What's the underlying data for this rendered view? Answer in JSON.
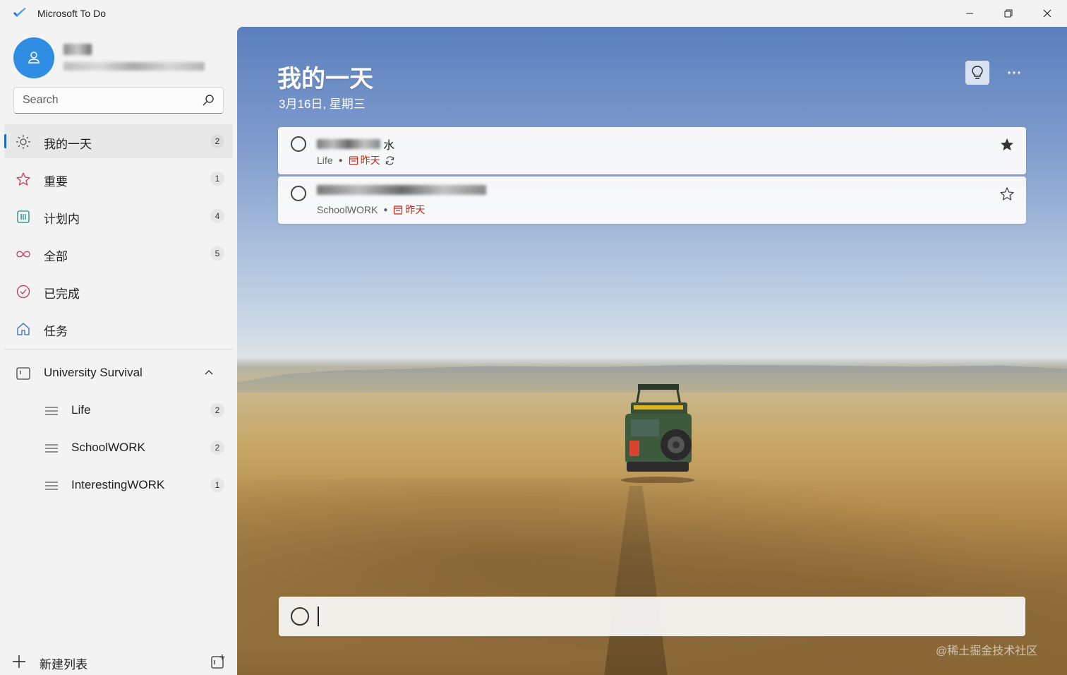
{
  "window": {
    "title": "Microsoft To Do",
    "controls": [
      "minimize",
      "restore",
      "close"
    ]
  },
  "sidebar": {
    "search": {
      "placeholder": "Search",
      "value": ""
    },
    "nav": [
      {
        "label": "我的一天",
        "count": "2",
        "icon": "sun-icon",
        "active": true
      },
      {
        "label": "重要",
        "count": "1",
        "icon": "star-icon"
      },
      {
        "label": "计划内",
        "count": "4",
        "icon": "calendar-grid-icon"
      },
      {
        "label": "全部",
        "count": "5",
        "icon": "infinity-icon"
      },
      {
        "label": "已完成",
        "count": "",
        "icon": "check-circle-icon"
      },
      {
        "label": "任务",
        "count": "",
        "icon": "home-icon"
      }
    ],
    "group": {
      "label": "University Survival",
      "expanded": true,
      "lists": [
        {
          "label": "Life",
          "count": "2"
        },
        {
          "label": "SchoolWORK",
          "count": "2"
        },
        {
          "label": "InterestingWORK",
          "count": "1"
        }
      ]
    },
    "new_list_label": "新建列表"
  },
  "main": {
    "title": "我的一天",
    "date": "3月16日, 星期三",
    "tasks": [
      {
        "title_visible_suffix": "水",
        "list": "Life",
        "due": "昨天",
        "repeat": true,
        "important": true
      },
      {
        "title_visible_suffix": "",
        "list": "SchoolWORK",
        "due": "昨天",
        "repeat": false,
        "important": false
      }
    ],
    "add_task": {
      "value": ""
    }
  },
  "watermark": "@稀土掘金技术社区",
  "colors": {
    "accent": "#2564cf",
    "due": "#c42b1c",
    "avatar": "#2f8de4"
  }
}
